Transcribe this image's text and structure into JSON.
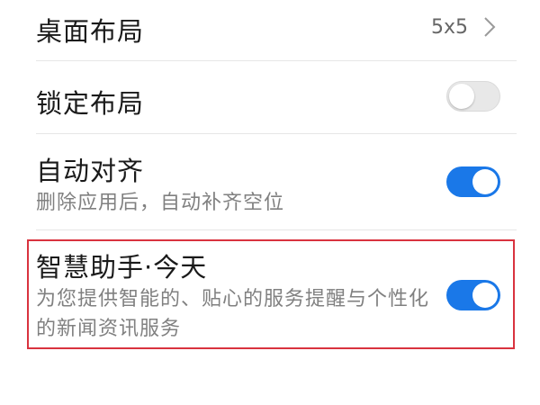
{
  "settings": {
    "desktop_layout": {
      "title": "桌面布局",
      "value": "5x5"
    },
    "lock_layout": {
      "title": "锁定布局",
      "enabled": false
    },
    "auto_align": {
      "title": "自动对齐",
      "description": "删除应用后，自动补齐空位",
      "enabled": true
    },
    "smart_assistant": {
      "title": "智慧助手·今天",
      "description": "为您提供智能的、贴心的服务提醒与个性化的新闻资讯服务",
      "enabled": true
    }
  },
  "colors": {
    "toggle_on": "#1a78e8",
    "toggle_off": "#e8e8e8",
    "highlight_border": "#d9333f"
  },
  "icons": {
    "chevron": "chevron-right-icon"
  }
}
